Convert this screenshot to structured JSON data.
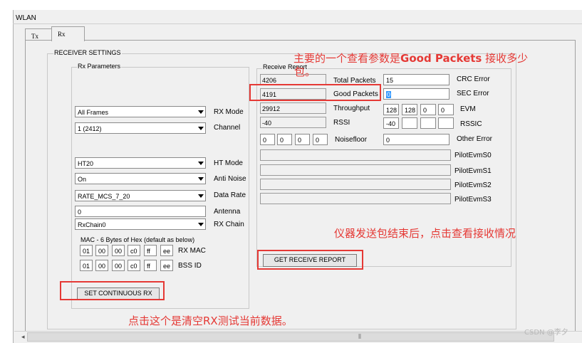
{
  "window": {
    "title": "WLAN"
  },
  "tabs": [
    {
      "label": "Tx"
    },
    {
      "label": "Rx"
    }
  ],
  "receiver": {
    "group_label": "RECEIVER SETTINGS",
    "rx_params_label": "Rx Parameters",
    "rx_mode": {
      "value": "All Frames",
      "label": "RX Mode"
    },
    "channel": {
      "value": "1 (2412)",
      "label": "Channel"
    },
    "ht_mode": {
      "value": "HT20",
      "label": "HT Mode"
    },
    "anti_noise": {
      "value": "On",
      "label": "Anti Noise"
    },
    "data_rate": {
      "value": "RATE_MCS_7_20",
      "label": "Data Rate"
    },
    "antenna": {
      "value": "0",
      "label": "Antenna"
    },
    "rx_chain": {
      "value": "RxChain0",
      "label": "RX Chain"
    },
    "mac_caption": "MAC - 6 Bytes of Hex (default as below)",
    "rx_mac": {
      "label": "RX MAC",
      "bytes": [
        "01",
        "00",
        "00",
        "c0",
        "ff",
        "ee"
      ]
    },
    "bss_id": {
      "label": "BSS ID",
      "bytes": [
        "01",
        "00",
        "00",
        "c0",
        "ff",
        "ee"
      ]
    },
    "set_button": "SET CONTINUOUS RX"
  },
  "report": {
    "group_label": "Receive Report",
    "total_packets": {
      "value": "4206",
      "label": "Total Packets"
    },
    "good_packets": {
      "value": "4191",
      "label": "Good Packets"
    },
    "throughput": {
      "value": "29912",
      "label": "Throughput"
    },
    "rssi": {
      "value": "-40",
      "label": "RSSI"
    },
    "noisefloor": {
      "label": "Noisefloor",
      "values": [
        "0",
        "0",
        "0",
        "0"
      ]
    },
    "crc_error": {
      "value": "15",
      "label": "CRC Error"
    },
    "sec_error": {
      "value": "0",
      "label": "SEC Error"
    },
    "evm": {
      "label": "EVM",
      "values": [
        "128",
        "128",
        "0",
        "0"
      ]
    },
    "rssic": {
      "label": "RSSIC",
      "values": [
        "-40",
        "",
        "",
        ""
      ]
    },
    "other_error": {
      "value": "0",
      "label": "Other Error"
    },
    "pilot": [
      {
        "label": "PilotEvmS0",
        "value": ""
      },
      {
        "label": "PilotEvmS1",
        "value": ""
      },
      {
        "label": "PilotEvmS2",
        "value": ""
      },
      {
        "label": "PilotEvmS3",
        "value": ""
      }
    ],
    "get_button": "GET RECEIVE REPORT"
  },
  "annotations": {
    "note1_prefix": "主要的一个查看参数是",
    "note1_bold": "Good Packets",
    "note1_suffix": " 接收多少",
    "note1_line2": "包。",
    "note2": "仪器发送包结束后，点击查看接收情况",
    "note3": "点击这个是清空RX测试当前数据。",
    "color": "#e53935"
  },
  "scrollbar": {
    "grip": "⦀"
  },
  "watermark": "CSDN @李夕"
}
